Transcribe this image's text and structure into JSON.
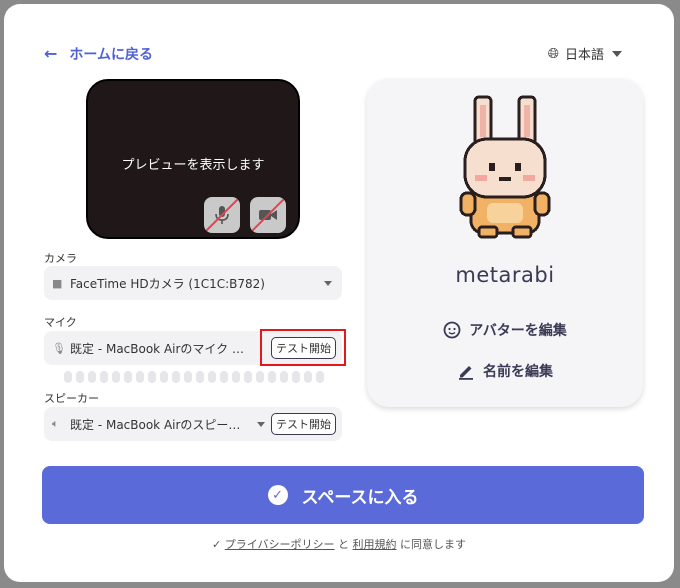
{
  "header": {
    "home_link": "ホームに戻る",
    "language": "日本語"
  },
  "preview": {
    "text": "プレビューを表示します"
  },
  "camera": {
    "label": "カメラ",
    "value": "FaceTime HDカメラ (1C1C:B782)"
  },
  "mic": {
    "label": "マイク",
    "value": "既定 - MacBook Airのマイク …",
    "test_label": "テスト開始"
  },
  "speaker": {
    "label": "スピーカー",
    "value": "既定 - MacBook Airのスピー…",
    "test_label": "テスト開始"
  },
  "avatar": {
    "name": "metarabi",
    "edit_avatar": "アバターを編集",
    "edit_name": "名前を編集"
  },
  "enter_button": "スペースに入る",
  "agreement": {
    "privacy": "プライバシーポリシー",
    "and": "と",
    "terms": "利用規約",
    "suffix": "に同意します"
  },
  "colors": {
    "accent": "#5a6bd9",
    "link": "#4f62d6",
    "highlight": "#e4181c"
  }
}
